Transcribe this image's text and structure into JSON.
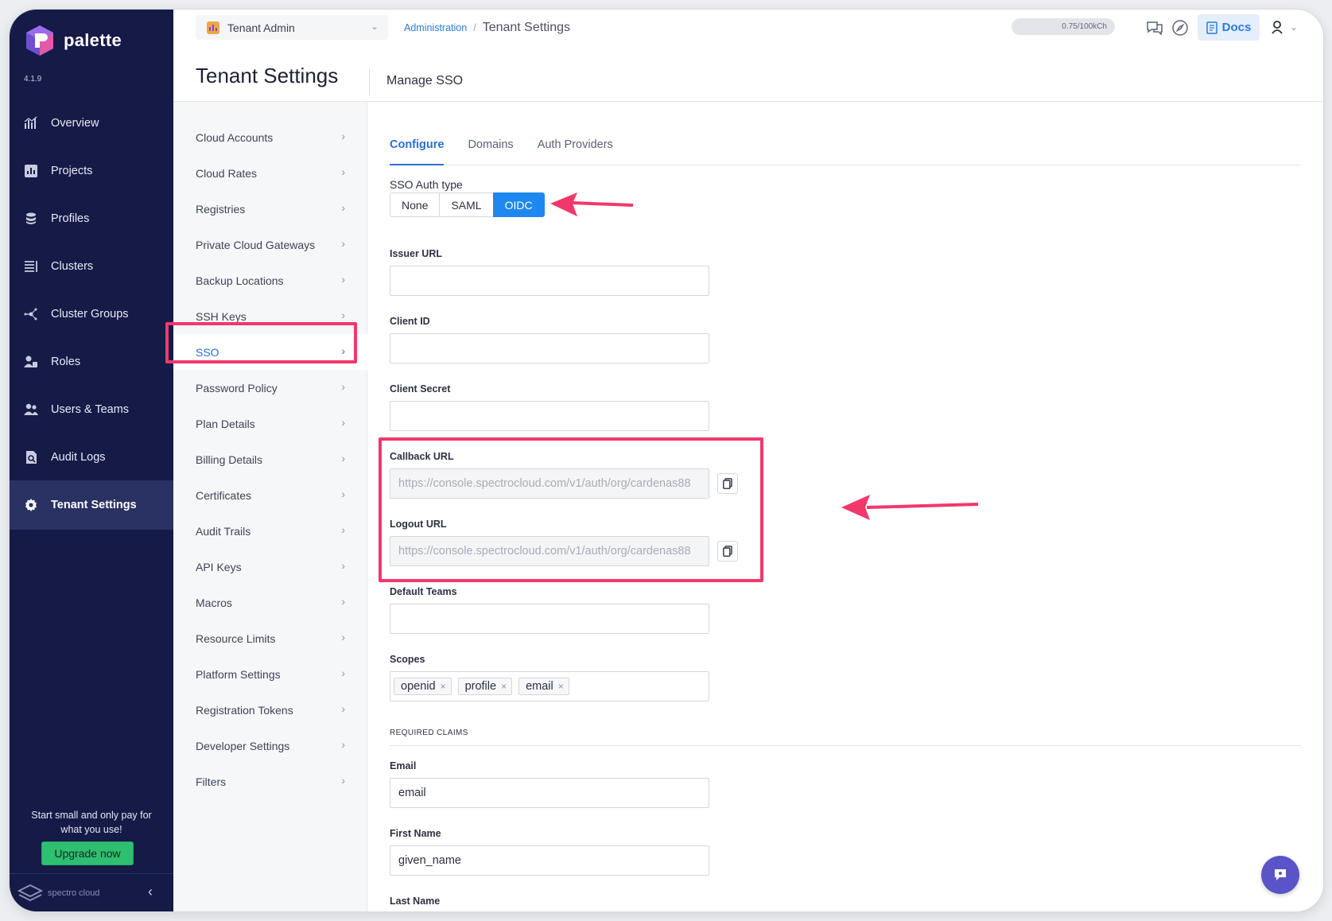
{
  "nav": {
    "brand": "palette",
    "version": "4.1.9",
    "items": [
      {
        "label": "Overview",
        "icon": "overview-icon"
      },
      {
        "label": "Projects",
        "icon": "projects-icon"
      },
      {
        "label": "Profiles",
        "icon": "profiles-icon"
      },
      {
        "label": "Clusters",
        "icon": "clusters-icon"
      },
      {
        "label": "Cluster Groups",
        "icon": "cluster-groups-icon"
      },
      {
        "label": "Roles",
        "icon": "roles-icon"
      },
      {
        "label": "Users & Teams",
        "icon": "users-teams-icon"
      },
      {
        "label": "Audit Logs",
        "icon": "audit-logs-icon"
      },
      {
        "label": "Tenant Settings",
        "icon": "gear-icon",
        "active": true
      }
    ],
    "promo": "Start small and only pay for what you use!",
    "upgrade": "Upgrade now",
    "footer_brand": "spectro cloud"
  },
  "header": {
    "tenant_scope": "Tenant Admin",
    "breadcrumb": {
      "parent": "Administration",
      "sep": "/",
      "current": "Tenant Settings"
    },
    "usage": "0.75/100kCh",
    "docs": "Docs"
  },
  "page": {
    "title": "Tenant Settings",
    "subtitle": "Manage SSO"
  },
  "settings_menu": [
    "Cloud Accounts",
    "Cloud Rates",
    "Registries",
    "Private Cloud Gateways",
    "Backup Locations",
    "SSH Keys",
    "SSO",
    "Password Policy",
    "Plan Details",
    "Billing Details",
    "Certificates",
    "Audit Trails",
    "API Keys",
    "Macros",
    "Resource Limits",
    "Platform Settings",
    "Registration Tokens",
    "Developer Settings",
    "Filters"
  ],
  "settings_active": "SSO",
  "tabs": [
    "Configure",
    "Domains",
    "Auth Providers"
  ],
  "form": {
    "auth_type_label": "SSO Auth type",
    "auth_types": [
      "None",
      "SAML",
      "OIDC"
    ],
    "auth_type_selected": "OIDC",
    "issuer_url_label": "Issuer URL",
    "issuer_url_value": "",
    "client_id_label": "Client ID",
    "client_id_value": "",
    "client_secret_label": "Client Secret",
    "client_secret_value": "",
    "callback_url_label": "Callback URL",
    "callback_url_value": "https://console.spectrocloud.com/v1/auth/org/cardenas88",
    "logout_url_label": "Logout URL",
    "logout_url_value": "https://console.spectrocloud.com/v1/auth/org/cardenas88",
    "default_teams_label": "Default Teams",
    "default_teams_value": "",
    "scopes_label": "Scopes",
    "scopes": [
      "openid",
      "profile",
      "email"
    ],
    "required_claims_heading": "REQUIRED CLAIMS",
    "email_label": "Email",
    "email_value": "email",
    "first_name_label": "First Name",
    "first_name_value": "given_name",
    "last_name_label": "Last Name",
    "last_name_value": ""
  },
  "colors": {
    "nav_bg": "#151a47",
    "accent": "#2b6fd1",
    "selected_seg": "#1e88f0",
    "highlight": "#f2386b",
    "upgrade": "#2fbf71"
  }
}
